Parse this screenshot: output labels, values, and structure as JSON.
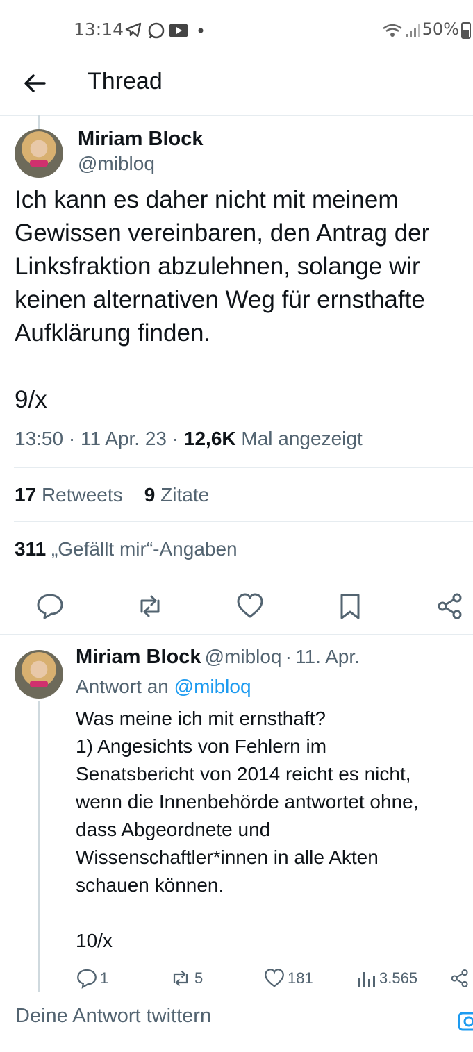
{
  "status_bar": {
    "time": "13:14",
    "battery": "50%"
  },
  "header": {
    "title": "Thread"
  },
  "main_tweet": {
    "author_name": "Miriam Block",
    "author_handle": "@mibloq",
    "text": "Ich kann es daher nicht mit meinem\nGewissen vereinbaren, den Antrag der\nLinksfraktion abzulehnen, solange wir\nkeinen alternativen Weg für ernsthafte\nAufklärung finden.\n\n9/x",
    "time": "13:50",
    "date": "11 Apr. 23",
    "views": "12,6K",
    "views_label": "Mal angezeigt",
    "retweets": "17",
    "retweets_label": "Retweets",
    "quotes": "9",
    "quotes_label": "Zitate",
    "likes": "311",
    "likes_label": "„Gefällt mir“-Angaben"
  },
  "reply_tweet": {
    "author_name": "Miriam Block",
    "author_handle": "@mibloq",
    "date": "11. Apr.",
    "reply_to_label": "Antwort an",
    "reply_to_handle": "@mibloq",
    "text": "Was meine ich mit ernsthaft?\n1) Angesichts von Fehlern im\nSenatsbericht von 2014 reicht es nicht,\nwenn die Innenbehörde antwortet ohne,\ndass Abgeordnete und\nWissenschaftler*innen in alle Akten\nschauen können.\n\n10/x",
    "replies": "1",
    "retweets": "5",
    "likes": "181",
    "views": "3.565"
  },
  "compose": {
    "placeholder": "Deine Antwort twittern"
  },
  "colors": {
    "accent": "#1d9bf0",
    "secondary_text": "#536471",
    "divider": "#e6ecf0"
  }
}
